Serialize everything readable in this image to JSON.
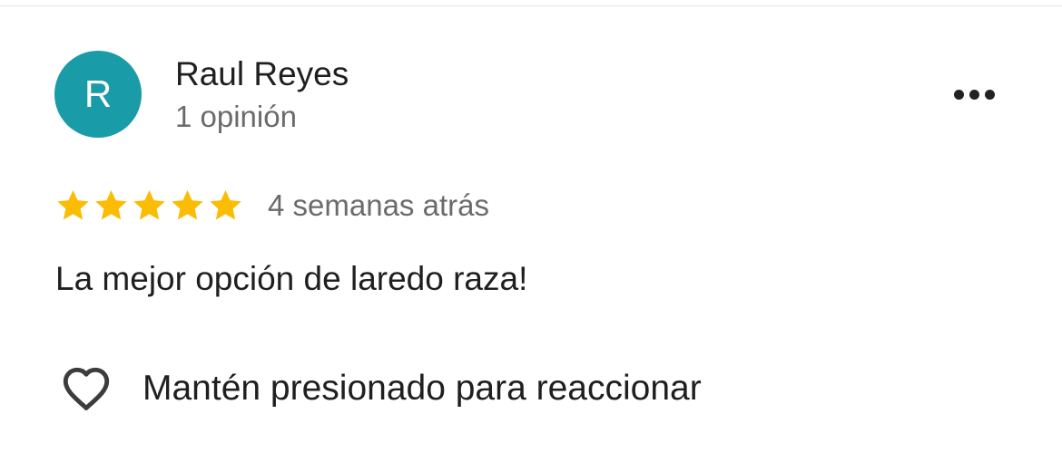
{
  "review": {
    "author": {
      "initial": "R",
      "name": "Raul Reyes",
      "meta": "1 opinión",
      "avatar_color": "#1a9ba8"
    },
    "more_options_icon": "more-horizontal-icon",
    "rating": {
      "value": 5,
      "max": 5,
      "star_color": "#fbbc04"
    },
    "time": "4 semanas atrás",
    "text": "La mejor opción de laredo raza!",
    "reaction": {
      "icon": "heart-outline-icon",
      "label": "Mantén presionado para reaccionar"
    }
  }
}
